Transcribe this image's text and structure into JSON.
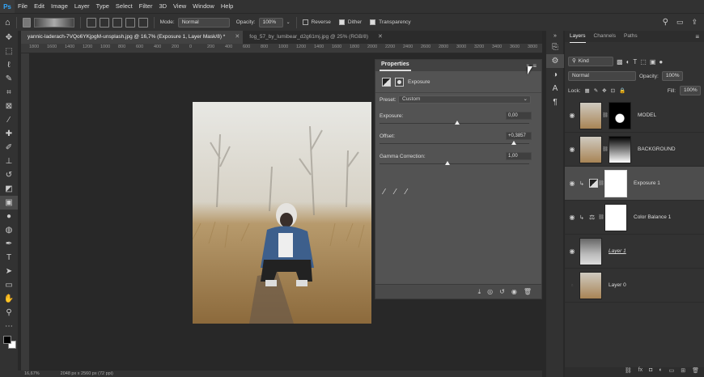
{
  "menu": [
    "File",
    "Edit",
    "Image",
    "Layer",
    "Type",
    "Select",
    "Filter",
    "3D",
    "View",
    "Window",
    "Help"
  ],
  "options": {
    "mode_label": "Mode:",
    "mode_value": "Normal",
    "opacity_label": "Opacity:",
    "opacity_value": "100%",
    "reverse": "Reverse",
    "dither": "Dither",
    "transparency": "Transparency"
  },
  "tabs": [
    "yannic-laderach-7VQo6YKjpgM-unsplash.jpg @ 16,7% (Exposure 1, Layer Mask/8) *",
    "fog_57_by_lumibear_d2g61mj.jpg @ 25% (RGB/8)"
  ],
  "ruler": [
    "1800",
    "1600",
    "1400",
    "1200",
    "1000",
    "800",
    "600",
    "400",
    "200",
    "0",
    "200",
    "400",
    "600",
    "800",
    "1000",
    "1200",
    "1400",
    "1600",
    "1800",
    "2000",
    "2200",
    "2400",
    "2600",
    "2800",
    "3000",
    "3200",
    "3400",
    "3600",
    "3800"
  ],
  "status": {
    "zoom": "16,67%",
    "size": "2048 px x 2560 px (72 ppi)"
  },
  "properties": {
    "tab": "Properties",
    "adjustment": "Exposure",
    "preset_label": "Preset:",
    "preset_value": "Custom",
    "exposure_label": "Exposure:",
    "exposure_value": "0,00",
    "offset_label": "Offset:",
    "offset_value": "+0,3857",
    "gamma_label": "Gamma Correction:",
    "gamma_value": "1,00"
  },
  "panels": {
    "layers_tab": "Layers",
    "channels_tab": "Channels",
    "paths_tab": "Paths",
    "kind_label": "Kind",
    "blend_mode": "Normal",
    "opacity_label": "Opacity:",
    "opacity_value": "100%",
    "lock_label": "Lock:",
    "fill_label": "Fill:",
    "fill_value": "100%"
  },
  "layers": [
    {
      "name": "MODEL"
    },
    {
      "name": "BACKGROUND"
    },
    {
      "name": "Exposure 1"
    },
    {
      "name": "Color Balance 1"
    },
    {
      "name": "Layer 1"
    },
    {
      "name": "Layer 0"
    }
  ],
  "icons": {
    "home": "home-icon",
    "search": "search-icon",
    "eye": "eye-icon"
  }
}
